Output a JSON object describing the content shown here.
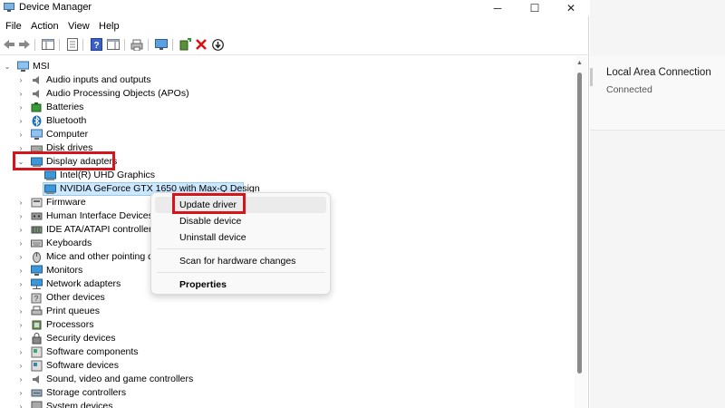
{
  "window": {
    "title": "Device Manager",
    "controls": {
      "minimize": "─",
      "maximize": "☐",
      "close": "✕"
    }
  },
  "menu": [
    "File",
    "Action",
    "View",
    "Help"
  ],
  "toolbar": {
    "icons": [
      "back-arrow-icon",
      "forward-arrow-icon",
      "show-hide-console-tree-icon",
      "properties-icon",
      "help-icon",
      "action-pane-icon",
      "print-icon",
      "monitor-icon",
      "add-driver-icon",
      "uninstall-icon",
      "update-driver-icon"
    ]
  },
  "tree": {
    "root": "MSI",
    "items": [
      {
        "label": "Audio inputs and outputs",
        "icon": "speaker-icon"
      },
      {
        "label": "Audio Processing Objects (APOs)",
        "icon": "speaker-icon"
      },
      {
        "label": "Batteries",
        "icon": "battery-icon"
      },
      {
        "label": "Bluetooth",
        "icon": "bluetooth-icon"
      },
      {
        "label": "Computer",
        "icon": "computer-icon"
      },
      {
        "label": "Disk drives",
        "icon": "disk-icon"
      },
      {
        "label": "Display adapters",
        "icon": "display-adapter-icon",
        "expanded": true,
        "children": [
          {
            "label": "Intel(R) UHD Graphics",
            "icon": "display-adapter-icon"
          },
          {
            "label": "NVIDIA GeForce GTX 1650 with Max-Q Design",
            "icon": "display-adapter-icon",
            "selected": true
          }
        ]
      },
      {
        "label": "Firmware",
        "icon": "firmware-icon"
      },
      {
        "label": "Human Interface Devices",
        "icon": "hid-icon"
      },
      {
        "label": "IDE ATA/ATAPI controllers",
        "icon": "ide-icon"
      },
      {
        "label": "Keyboards",
        "icon": "keyboard-icon"
      },
      {
        "label": "Mice and other pointing d",
        "icon": "mouse-icon"
      },
      {
        "label": "Monitors",
        "icon": "monitor-icon"
      },
      {
        "label": "Network adapters",
        "icon": "network-icon"
      },
      {
        "label": "Other devices",
        "icon": "other-devices-icon"
      },
      {
        "label": "Print queues",
        "icon": "printer-icon"
      },
      {
        "label": "Processors",
        "icon": "processor-icon"
      },
      {
        "label": "Security devices",
        "icon": "security-icon"
      },
      {
        "label": "Software components",
        "icon": "software-icon"
      },
      {
        "label": "Software devices",
        "icon": "software-icon"
      },
      {
        "label": "Sound, video and game controllers",
        "icon": "sound-icon"
      },
      {
        "label": "Storage controllers",
        "icon": "storage-icon"
      },
      {
        "label": "System devices",
        "icon": "system-icon"
      }
    ]
  },
  "context_menu": {
    "items": [
      {
        "label": "Update driver",
        "highlighted": true
      },
      {
        "label": "Disable device"
      },
      {
        "label": "Uninstall device"
      },
      {
        "label": "Scan for hardware changes"
      },
      {
        "label": "Properties",
        "bold": true
      }
    ]
  },
  "right_panel": {
    "title": "Local Area Connection",
    "status": "Connected"
  },
  "colors": {
    "selection": "#cce8ff",
    "annotation_red": "#d3161c",
    "accent_blue": "#1e6fbf"
  }
}
